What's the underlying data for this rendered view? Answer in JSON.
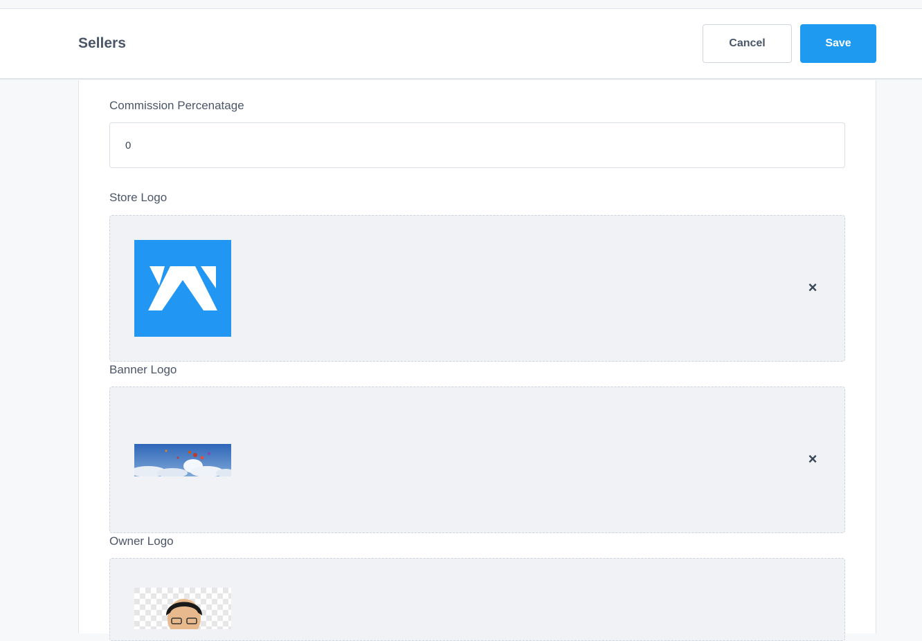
{
  "header": {
    "title": "Sellers",
    "cancel_label": "Cancel",
    "save_label": "Save"
  },
  "form": {
    "commission": {
      "label": "Commission Percenatage",
      "value": "0"
    },
    "store_logo": {
      "label": "Store Logo",
      "remove_glyph": "×"
    },
    "banner_logo": {
      "label": "Banner Logo",
      "remove_glyph": "×"
    },
    "owner_logo": {
      "label": "Owner Logo"
    }
  },
  "colors": {
    "accent": "#1e9bf0",
    "store_logo_bg": "#2196f3"
  },
  "icons": {
    "remove": "close-icon"
  }
}
